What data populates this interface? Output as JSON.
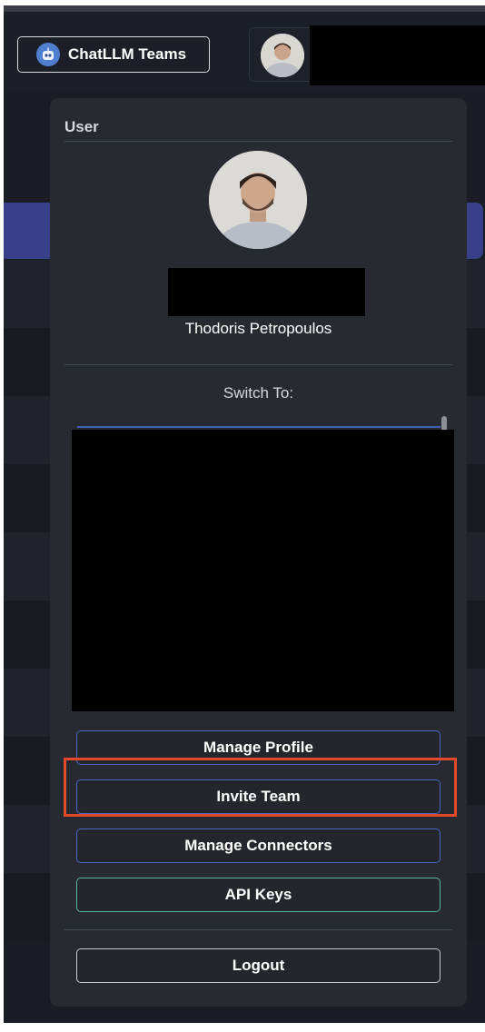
{
  "header": {
    "brand_label": "ChatLLM Teams",
    "brand_icon": "robot-icon"
  },
  "user_menu": {
    "section_title": "User",
    "user_name": "Thodoris Petropoulos",
    "switch_to_label": "Switch To:",
    "buttons": {
      "manage_profile": "Manage Profile",
      "invite_team": "Invite Team",
      "manage_connectors": "Manage Connectors",
      "api_keys": "API Keys",
      "logout": "Logout"
    }
  },
  "colors": {
    "background": "#1a1d25",
    "panel": "#272a31",
    "accent_blue": "#4a66c8",
    "accent_green": "#58b79b",
    "highlight_red": "#e4492a"
  }
}
